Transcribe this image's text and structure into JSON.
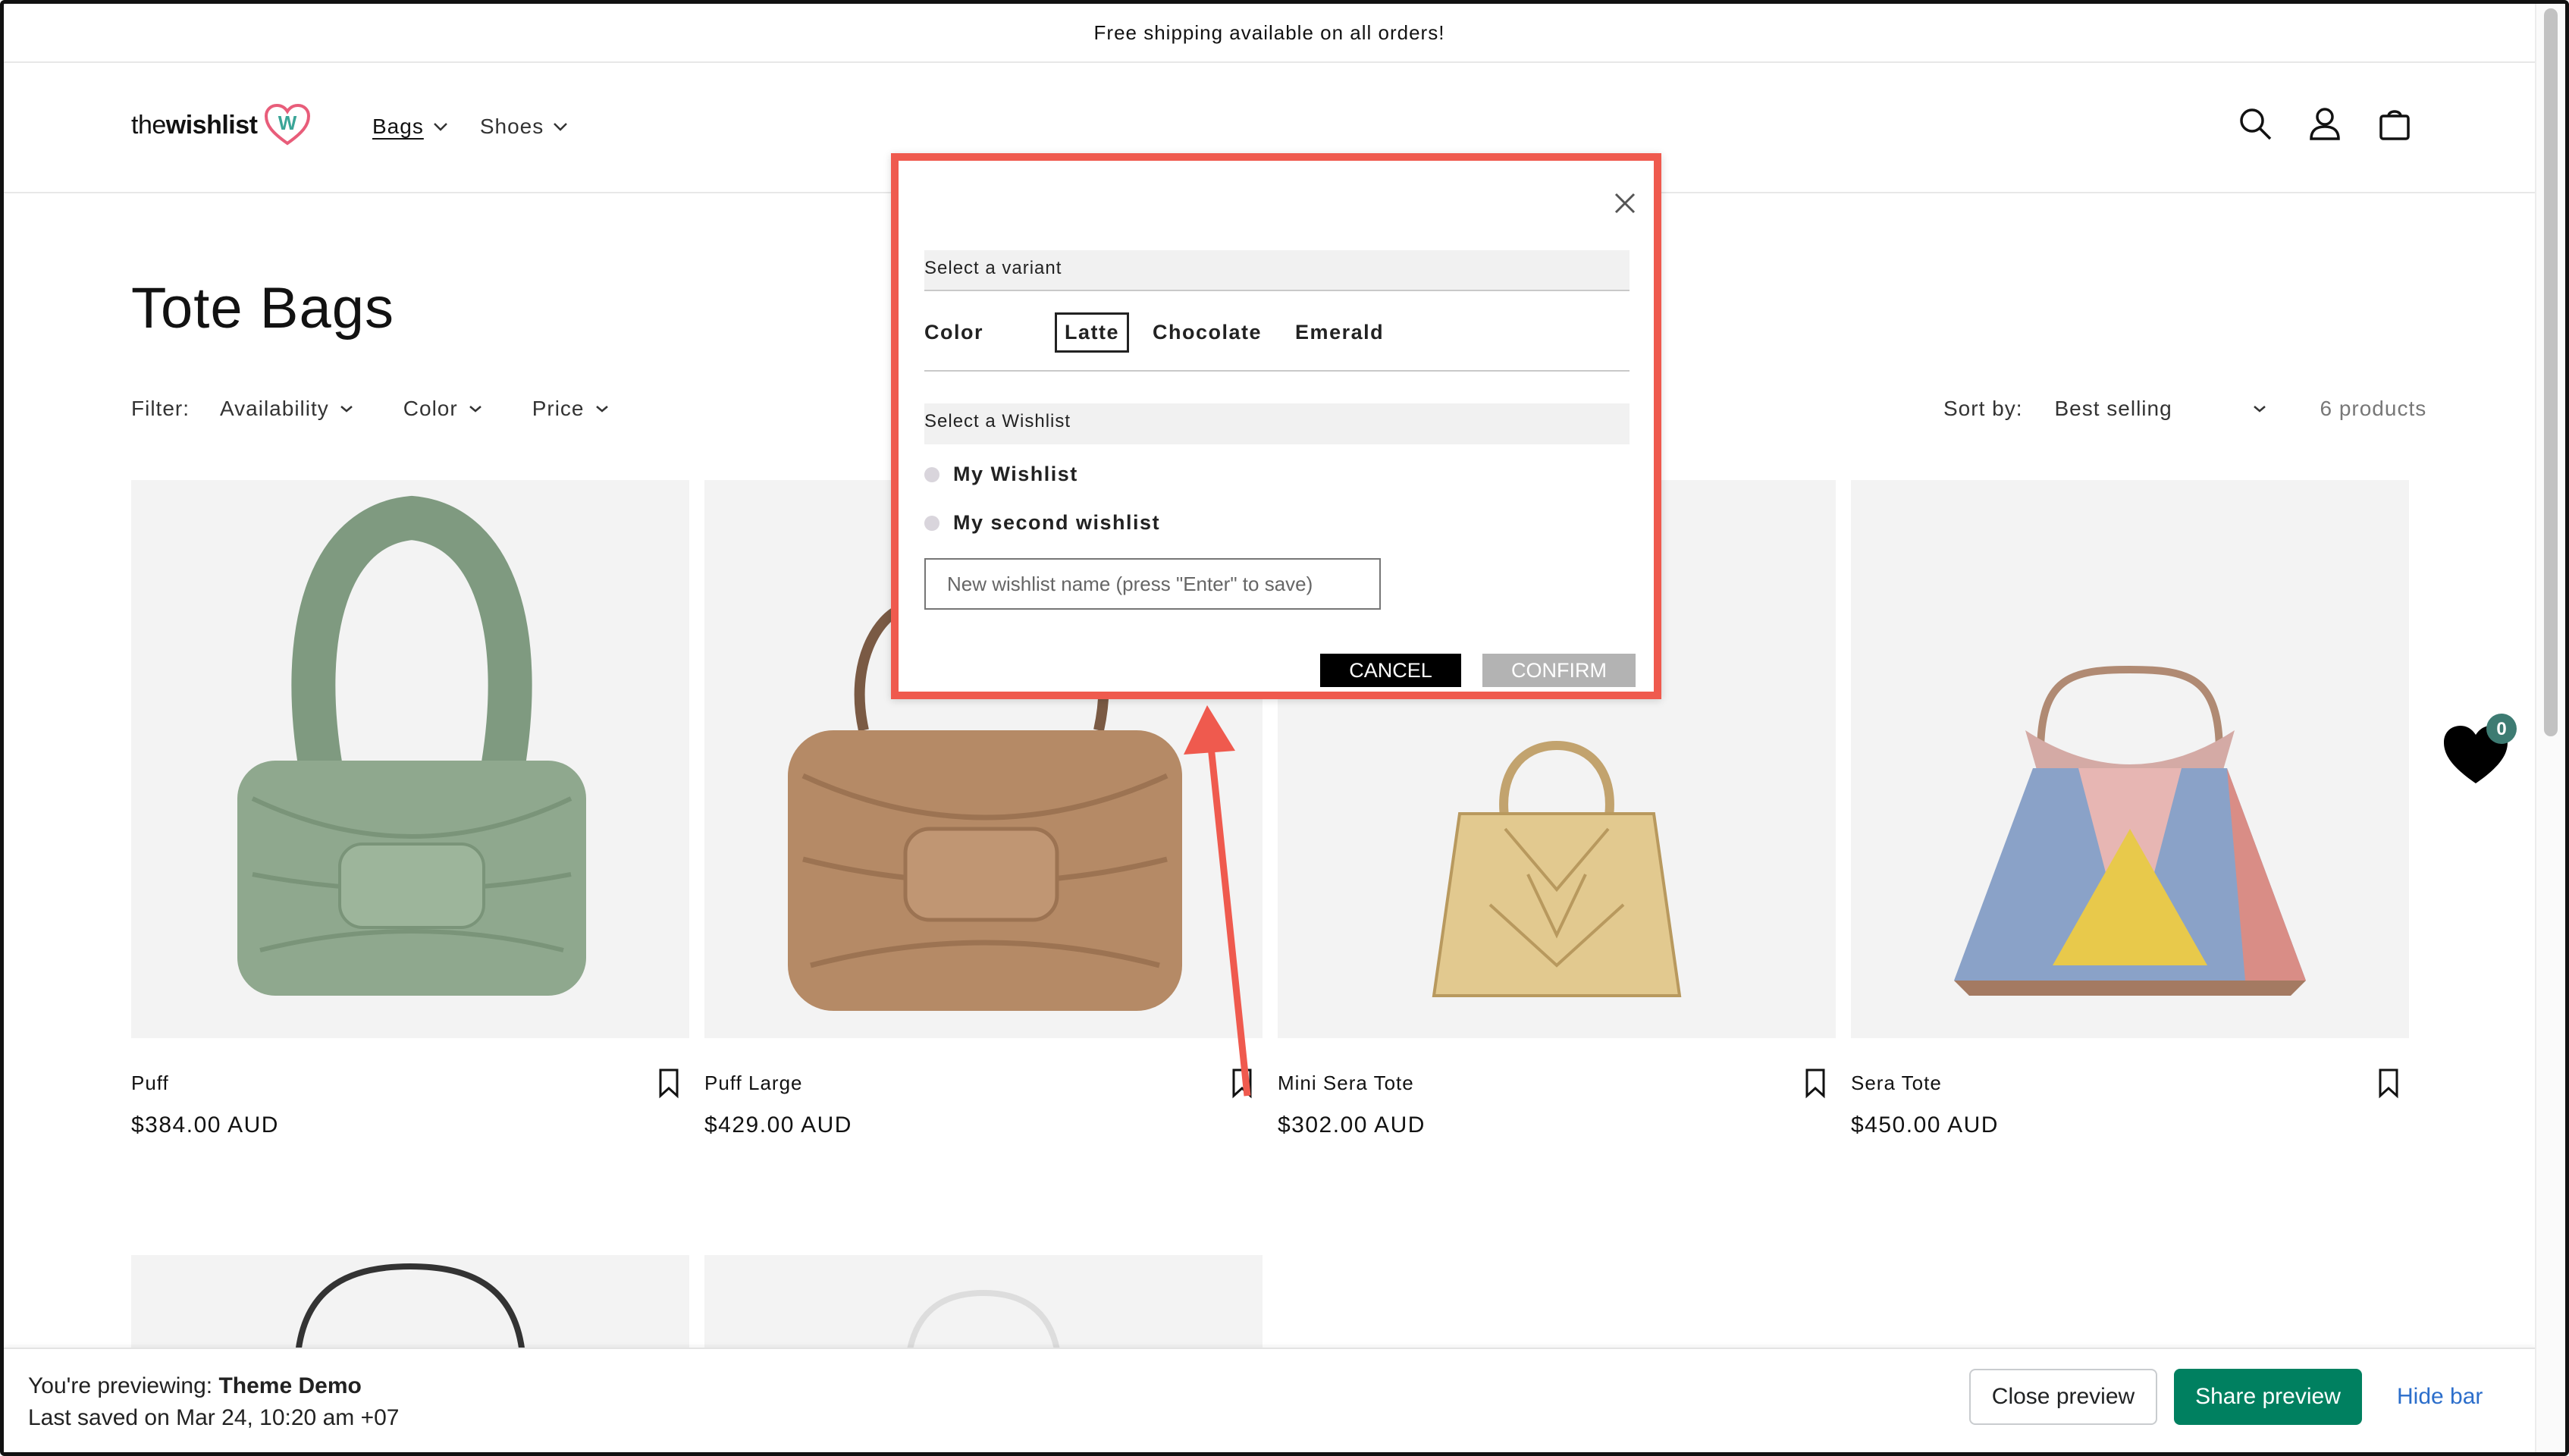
{
  "announcement": "Free shipping available on all orders!",
  "header": {
    "logo_text_1": "the",
    "logo_text_2": "wishlist",
    "logo_mark": "W",
    "nav": [
      {
        "label": "Bags"
      },
      {
        "label": "Shoes"
      }
    ]
  },
  "collection": {
    "title": "Tote Bags",
    "filter_label": "Filter:",
    "filters": [
      "Availability",
      "Color",
      "Price"
    ],
    "sort_label": "Sort by:",
    "sort_value": "Best selling",
    "product_count": "6 products"
  },
  "products": [
    {
      "name": "Puff",
      "price": "$384.00 AUD"
    },
    {
      "name": "Puff Large",
      "price": "$429.00 AUD"
    },
    {
      "name": "Mini Sera Tote",
      "price": "$302.00 AUD"
    },
    {
      "name": "Sera Tote",
      "price": "$450.00 AUD"
    }
  ],
  "wishlist_float": {
    "count": "0"
  },
  "modal": {
    "variant_header": "Select a variant",
    "color_label": "Color",
    "colors": [
      "Latte",
      "Chocolate",
      "Emerald"
    ],
    "selected_color": "Latte",
    "wishlist_header": "Select a Wishlist",
    "wishlists": [
      "My Wishlist",
      "My second wishlist"
    ],
    "new_wishlist_placeholder": "New wishlist name (press \"Enter\" to save)",
    "cancel_label": "CANCEL",
    "confirm_label": "CONFIRM"
  },
  "preview_bar": {
    "previewing_prefix": "You're previewing:",
    "theme_name": "Theme Demo",
    "last_saved": "Last saved on Mar 24, 10:20 am +07",
    "close_label": "Close preview",
    "share_label": "Share preview",
    "hide_label": "Hide bar"
  },
  "colors": {
    "accent_annotation": "#ef5a4e",
    "share_button": "#008060",
    "hide_link": "#2c6ecb",
    "logo_heart": "#e85d7a",
    "logo_w": "#3aa597"
  }
}
